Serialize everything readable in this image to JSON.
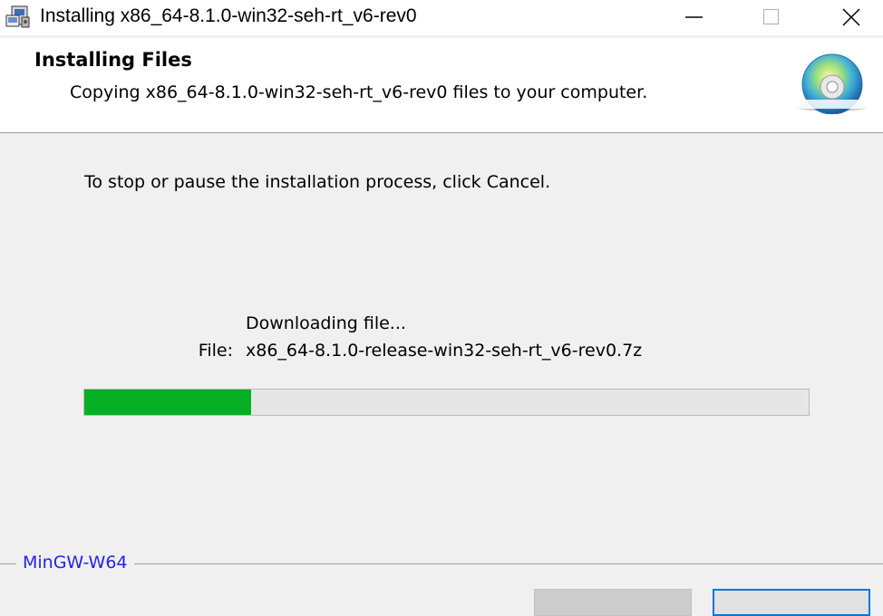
{
  "window": {
    "title": "Installing x86_64-8.1.0-win32-seh-rt_v6-rev0",
    "controls": {
      "minimize_icon": "minimize-icon",
      "maximize_icon": "maximize-icon",
      "close_icon": "close-icon"
    }
  },
  "header": {
    "title": "Installing Files",
    "subtitle": "Copying x86_64-8.1.0-win32-seh-rt_v6-rev0 files to your computer.",
    "icon": "cd-disc-icon"
  },
  "body": {
    "instruction": "To stop or pause the installation process, click Cancel.",
    "status_text": "Downloading file...",
    "file_label": "File:",
    "file_name": "x86_64-8.1.0-release-win32-seh-rt_v6-rev0.7z",
    "progress_fraction": 0.23,
    "progress_color": "#06b025"
  },
  "footer": {
    "brand": "MinGW-W64"
  }
}
